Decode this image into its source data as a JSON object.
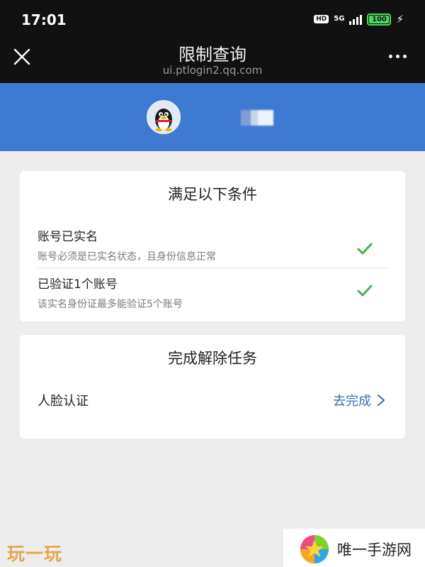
{
  "status_bar": {
    "time": "17:01",
    "hd": "HD",
    "network": "5G",
    "battery": "100",
    "icons": [
      "hd-icon",
      "5g-icon",
      "signal-icon",
      "battery-icon",
      "charging-bolt-icon"
    ]
  },
  "nav": {
    "title": "限制查询",
    "subtitle": "ui.ptlogin2.qq.com",
    "close_icon": "close-icon",
    "more_icon": "more-icon"
  },
  "header": {
    "background": "#3f7ad2",
    "avatar_icon": "qq-penguin-avatar-icon"
  },
  "conditions": {
    "title": "满足以下条件",
    "items": [
      {
        "title": "账号已实名",
        "desc": "账号必须是已实名状态，且身份信息正常",
        "status_icon": "check-icon"
      },
      {
        "title": "已验证1个账号",
        "desc": "该实名身份证最多能验证5个账号",
        "status_icon": "check-icon"
      }
    ],
    "check_color": "#4caf50"
  },
  "task": {
    "title": "完成解除任务",
    "item_label": "人脸认证",
    "action_label": "去完成",
    "action_icon": "chevron-right-icon",
    "link_color": "#3a6fb6"
  },
  "watermarks": {
    "left": "玩一玩",
    "right": "唯一手游网",
    "right_logo_icon": "star-logo-icon"
  }
}
